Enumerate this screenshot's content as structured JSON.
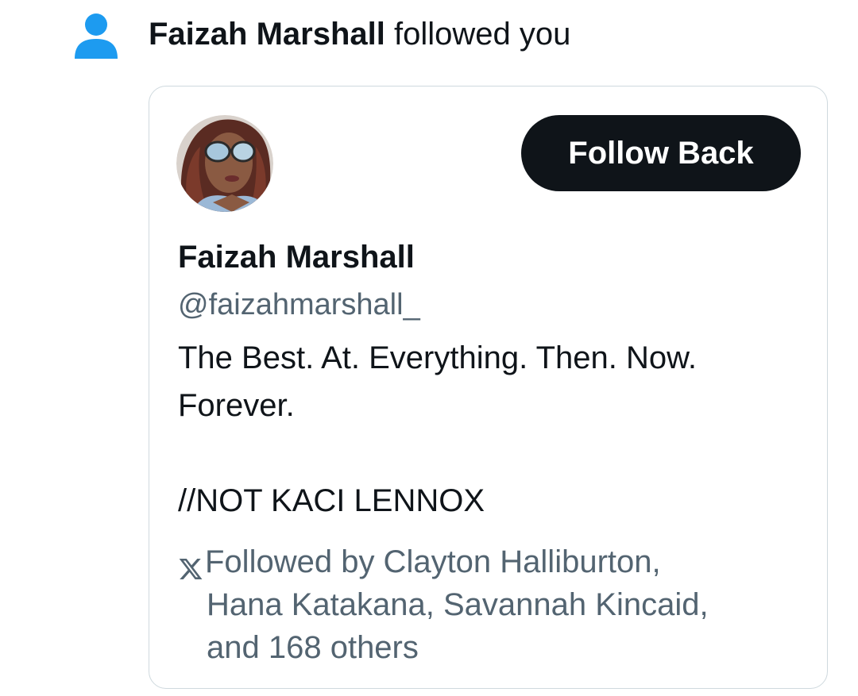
{
  "notification": {
    "icon": "person-icon",
    "name": "Faizah Marshall",
    "action": " followed you",
    "icon_color": "#1d9bf0"
  },
  "card": {
    "avatar": "profile-photo",
    "follow_button_label": "Follow Back",
    "display_name": "Faizah Marshall",
    "handle": "@faizahmarshall_",
    "bio_lines": [
      "The Best. At. Everything. Then. Now.",
      "Forever.",
      "",
      "//NOT KACI LENNOX"
    ],
    "followed_by_icon": "x-logo-icon",
    "followed_by_lines": [
      "Followed by Clayton Halliburton,",
      "Hana Katakana, Savannah Kincaid,",
      "and 168 others"
    ]
  },
  "colors": {
    "text_primary": "#0f1419",
    "text_secondary": "#536471",
    "border": "#cfd9de",
    "button_bg": "#0f1419",
    "button_text": "#ffffff"
  }
}
